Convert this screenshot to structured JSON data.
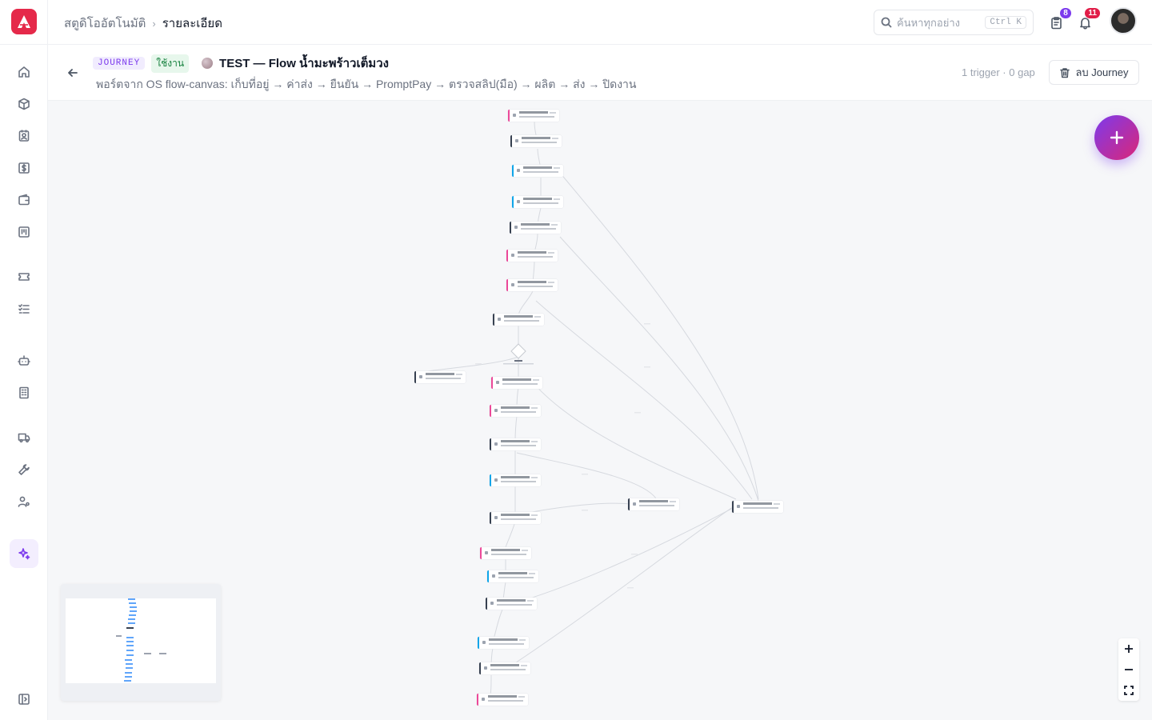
{
  "app": {
    "logo_icon": "app-logo",
    "brand_color": "#e5294a"
  },
  "breadcrumb": {
    "parent": "สตูดิโออัตโนมัติ",
    "current": "รายละเอียด"
  },
  "search": {
    "placeholder": "ค้นหาทุกอย่าง",
    "shortcut": "Ctrl K"
  },
  "topbar": {
    "tasks_badge": "8",
    "tasks_badge_color": "#7c3aed",
    "notifications_badge": "11",
    "notifications_badge_color": "#e11d48"
  },
  "sidebar": {
    "items": [
      {
        "icon": "home-icon"
      },
      {
        "icon": "box-icon"
      },
      {
        "icon": "contact-icon"
      },
      {
        "icon": "dollar-icon"
      },
      {
        "icon": "wallet-icon"
      },
      {
        "icon": "board-icon"
      },
      {
        "icon": "ticket-icon"
      },
      {
        "icon": "checklist-icon"
      },
      {
        "icon": "robot-icon"
      },
      {
        "icon": "building-icon"
      },
      {
        "icon": "truck-icon"
      },
      {
        "icon": "wrench-icon"
      },
      {
        "icon": "user-gear-icon"
      },
      {
        "icon": "sparkles-icon",
        "active": true
      },
      {
        "icon": "sidebar-toggle-icon"
      }
    ]
  },
  "journey": {
    "type_tag": "JOURNEY",
    "status_tag": "ใช้งาน",
    "title": "TEST — Flow น้ำมะพร้าวเต็มวง",
    "description": "พอร์ตจาก OS flow-canvas: เก็บที่อยู่ → ค่าส่ง → ยืนยัน → PromptPay → ตรวจสลิป(มือ) → ผลิต → ส่ง → ปิดงาน",
    "meta": "1 trigger · 0 gap",
    "delete_label": "ลบ Journey"
  },
  "canvas": {
    "add_button_icon": "plus-icon",
    "zoom_in_icon": "plus-icon",
    "zoom_out_icon": "minus-icon",
    "fit_view_icon": "fit-view-icon",
    "accent_gradient": [
      "#7c3aed",
      "#db2777"
    ],
    "node_colors": {
      "message": "#ec4899",
      "wait": "#374151",
      "action": "#0ea5e9"
    }
  }
}
